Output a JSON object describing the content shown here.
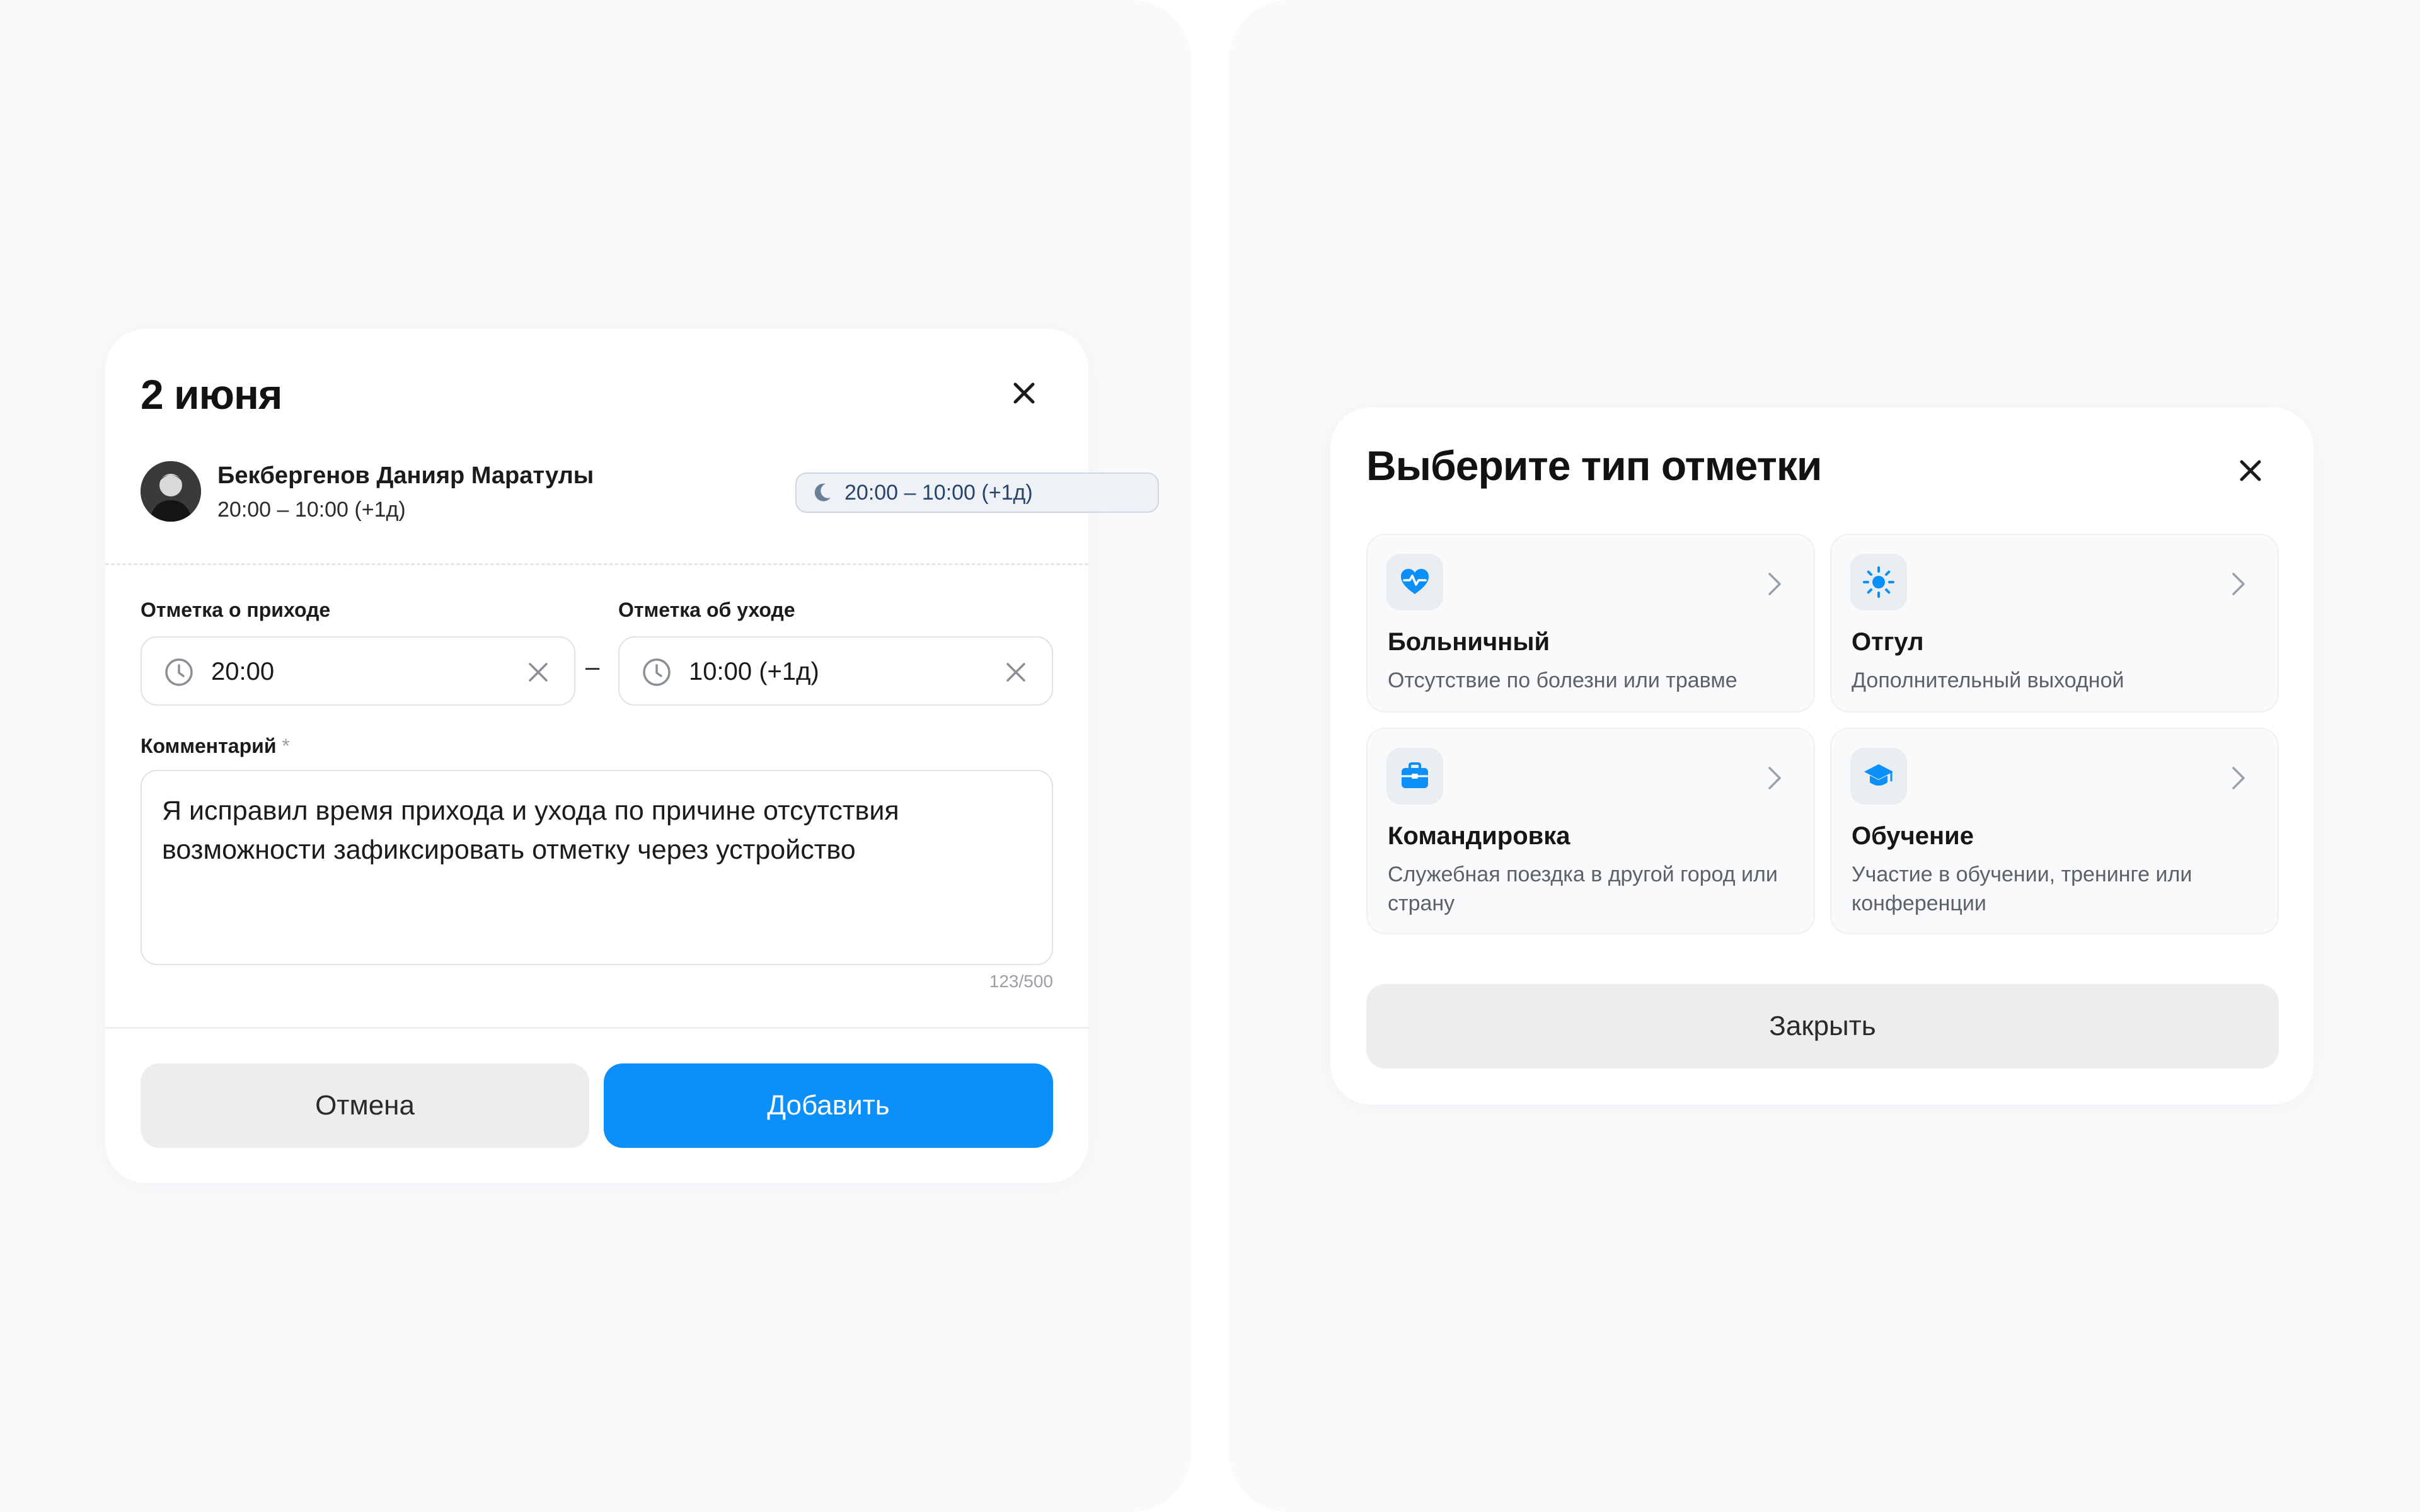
{
  "entry_modal": {
    "title": "2 июня",
    "employee": {
      "name": "Бекбергенов Данияр Маратулы",
      "time": "20:00 – 10:00 (+1д)"
    },
    "shift_badge": "20:00 – 10:00 (+1д)",
    "arrival": {
      "label": "Отметка о приходе",
      "value": "20:00"
    },
    "departure": {
      "label": "Отметка об уходе",
      "value": "10:00 (+1д)"
    },
    "range_separator": "–",
    "comment": {
      "label": "Комментарий",
      "required_mark": "*",
      "value": "Я исправил время прихода и ухода по причине отсутствия возможности зафиксировать отметку через устройство",
      "counter": "123/500"
    },
    "cancel_label": "Отмена",
    "add_label": "Добавить",
    "colors": {
      "primary": "#0a8ffb",
      "secondary": "#eceeed"
    }
  },
  "type_modal": {
    "title": "Выберите тип отметки",
    "options": [
      {
        "icon": "heart-pulse-icon",
        "name": "Больничный",
        "description": "Отсутствие по болезни или травме"
      },
      {
        "icon": "sun-icon",
        "name": "Отгул",
        "description": "Дополнительный выходной"
      },
      {
        "icon": "briefcase-icon",
        "name": "Командировка",
        "description": "Служебная поездка в другой город или страну"
      },
      {
        "icon": "graduation-cap-icon",
        "name": "Обучение",
        "description": "Участие в обучении, тренинге или конференции"
      }
    ],
    "close_label": "Закрыть",
    "colors": {
      "icon_accent": "#0a8ffb"
    }
  }
}
